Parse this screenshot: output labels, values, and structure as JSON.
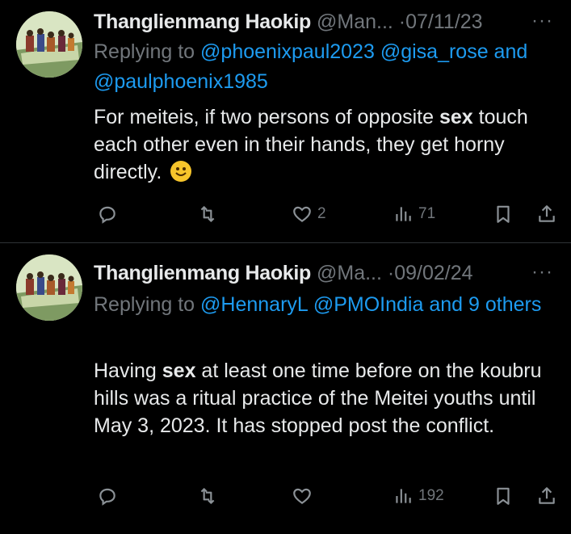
{
  "tweets": [
    {
      "name": "Thanglienmang Haokip",
      "handle": "@Man...",
      "separator": "·",
      "date": "07/11/23",
      "more": "···",
      "replying_prefix": "Replying to ",
      "replying_links": [
        "@phoenixpaul2023",
        "@gisa_rose",
        "@paulphoenix1985"
      ],
      "replying_and": " and ",
      "body_before": "For meiteis, if two persons of opposite ",
      "body_bold": "sex",
      "body_after": " touch each other even in their hands, they get horny directly.",
      "emoji": "smiling-face",
      "likes": "2",
      "views": "71"
    },
    {
      "name": "Thanglienmang Haokip",
      "handle": "@Ma...",
      "separator": "·",
      "date": "09/02/24",
      "more": "···",
      "replying_prefix": "Replying to ",
      "replying_links": [
        "@HennaryL",
        "@PMOIndia"
      ],
      "replying_and": " and ",
      "replying_others": "9 others",
      "body_before": "Having ",
      "body_bold": "sex",
      "body_after": " at least one time before on the koubru hills was a ritual practice of the Meitei youths until May 3, 2023. It has stopped post the conflict.",
      "likes": "",
      "views": "192"
    }
  ],
  "colors": {
    "background": "#000000",
    "text": "#e7e9ea",
    "muted": "#71767b",
    "link": "#1d9bf0",
    "divider": "#2f3336"
  },
  "icons": [
    "reply-icon",
    "retweet-icon",
    "like-icon",
    "views-icon",
    "bookmark-icon",
    "share-icon"
  ]
}
